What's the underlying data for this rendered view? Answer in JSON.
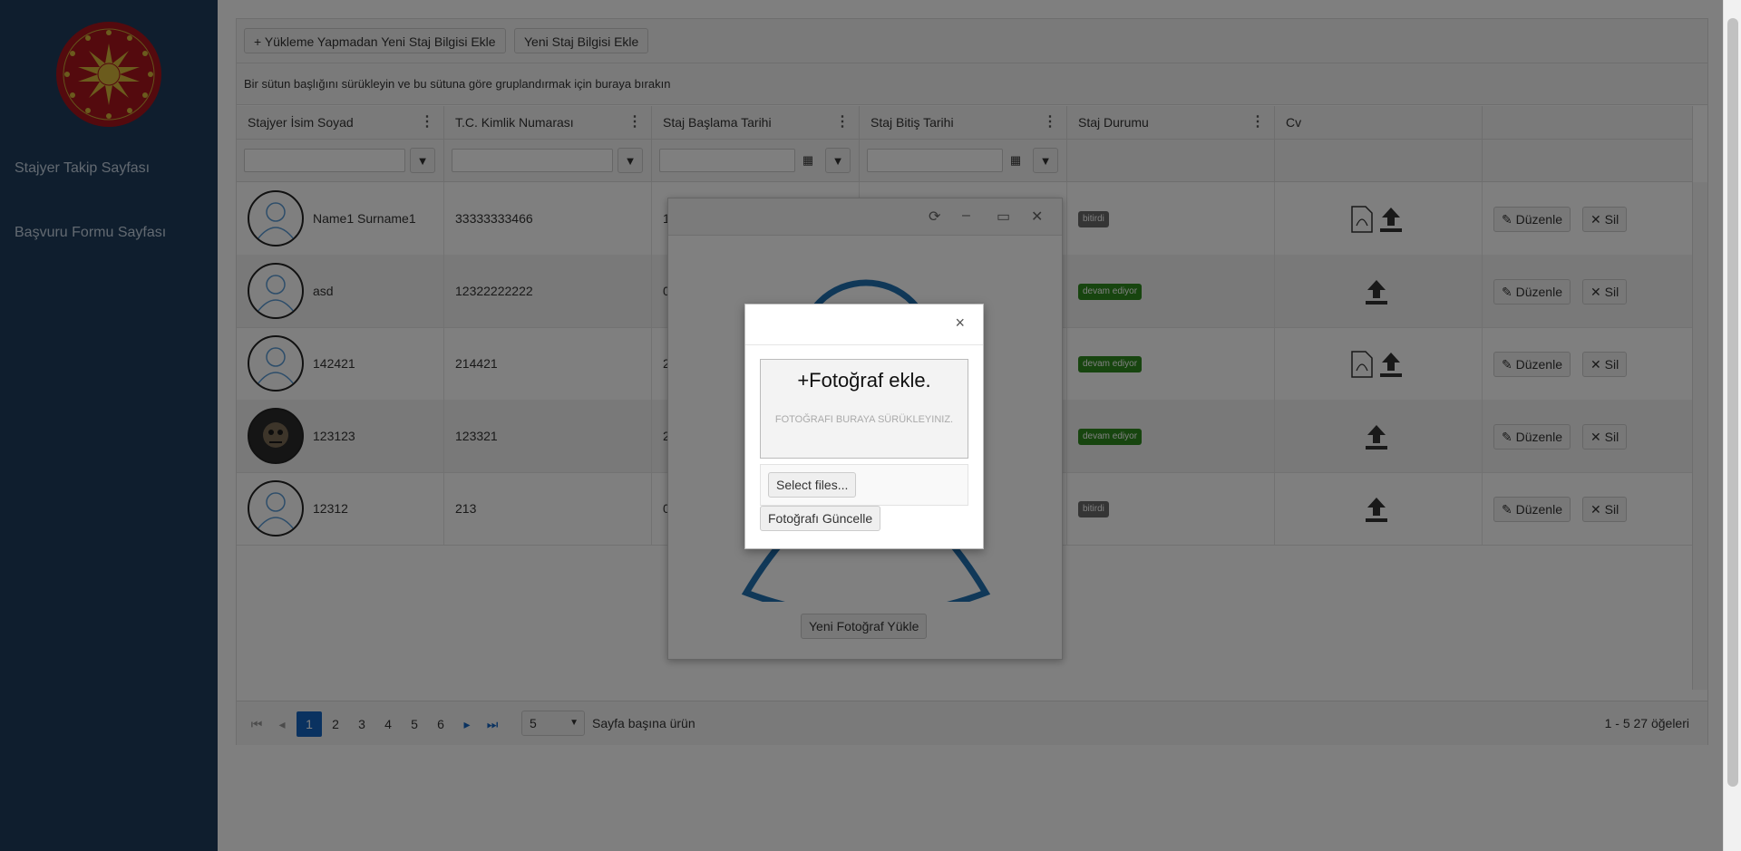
{
  "sidebar": {
    "links": [
      "Stajyer Takip Sayfası",
      "Başvuru Formu Sayfası"
    ]
  },
  "toolbar": {
    "add_without_upload": "+ Yükleme Yapmadan Yeni Staj Bilgisi Ekle",
    "add_new": "Yeni Staj Bilgisi Ekle"
  },
  "grouping_hint": "Bir sütun başlığını sürükleyin ve bu sütuna göre gruplandırmak için buraya bırakın",
  "columns": [
    "Stajyer İsim Soyad",
    "T.C. Kimlik Numarası",
    "Staj Başlama Tarihi",
    "Staj Bitiş Tarihi",
    "Staj Durumu",
    "Cv",
    ""
  ],
  "rows": [
    {
      "name": "Name1 Surname1",
      "tc": "33333333466",
      "start": "1",
      "status": "bitirdi",
      "edit": "Düzenle",
      "delete": "Sil"
    },
    {
      "name": "asd",
      "tc": "12322222222",
      "start": "0",
      "status": "devam ediyor",
      "edit": "Düzenle",
      "delete": "Sil"
    },
    {
      "name": "142421",
      "tc": "214421",
      "start": "2",
      "status": "devam ediyor",
      "edit": "Düzenle",
      "delete": "Sil"
    },
    {
      "name": "123123",
      "tc": "123321",
      "start": "2",
      "status": "devam ediyor",
      "edit": "Düzenle",
      "delete": "Sil"
    },
    {
      "name": "12312",
      "tc": "213",
      "start": "0",
      "status": "bitirdi",
      "edit": "Düzenle",
      "delete": "Sil"
    }
  ],
  "pager": {
    "pages": [
      "1",
      "2",
      "3",
      "4",
      "5",
      "6"
    ],
    "active_page": "1",
    "page_size": "5",
    "per_page_label": "Sayfa başına ürün",
    "summary": "1 - 5 27 öğeleri"
  },
  "photo_window": {
    "upload_button": "Yeni Fotoğraf Yükle"
  },
  "modal": {
    "close": "×",
    "title": "+Fotoğraf ekle.",
    "hint": "FOTOĞRAFI BURAYA SÜRÜKLEYINIZ.",
    "select_files": "Select files...",
    "update_button": "Fotoğrafı Güncelle"
  },
  "colors": {
    "sidebar": "#1f3d5c",
    "accent": "#1565c0",
    "badge_done": "#6b6b6b",
    "badge_progress": "#2e8b1e"
  }
}
